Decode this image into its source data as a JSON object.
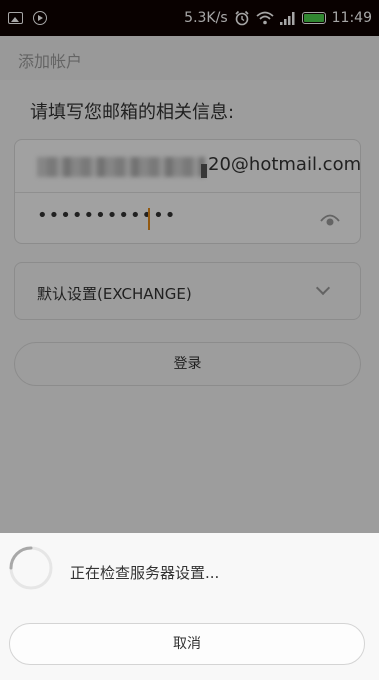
{
  "status_bar": {
    "speed": "5.3K/s",
    "time": "11:49",
    "icons": [
      "image-icon",
      "play-icon",
      "alarm-icon",
      "wifi-icon",
      "signal-icon",
      "battery-icon"
    ]
  },
  "app_bar": {
    "title": "添加帐户"
  },
  "form": {
    "prompt": "请填写您邮箱的相关信息:",
    "email_value": "20@hotmail.com",
    "password_value": "••••••••••••",
    "account_type": "默认设置(EXCHANGE)",
    "login_label": "登录"
  },
  "dialog": {
    "message": "正在检查服务器设置...",
    "cancel_label": "取消"
  },
  "colors": {
    "caret": "#e0891b",
    "battery": "#4cd04c"
  }
}
